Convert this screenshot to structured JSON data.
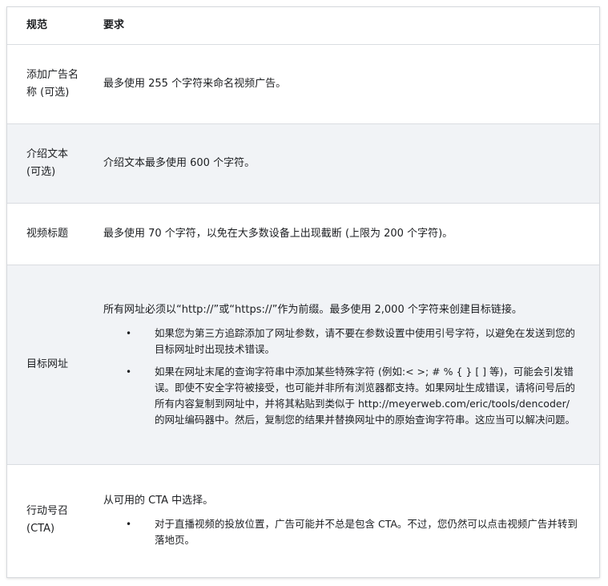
{
  "header": {
    "col1": "规范",
    "col2": "要求"
  },
  "rows": [
    {
      "label": "添加广告名称 (可选)",
      "text": "最多使用 255 个字符来命名视频广告。"
    },
    {
      "label": "介绍文本 (可选)",
      "text": "介绍文本最多使用 600 个字符。"
    },
    {
      "label": "视频标题",
      "text": "最多使用 70 个字符，以免在大多数设备上出现截断 (上限为 200 个字符)。"
    },
    {
      "label": "目标网址",
      "text": "所有网址必须以“http://”或“https://”作为前缀。最多使用 2,000 个字符来创建目标链接。",
      "bullets": [
        "如果您为第三方追踪添加了网址参数，请不要在参数设置中使用引号字符，以避免在发送到您的目标网址时出现技术错误。",
        "如果在网址末尾的查询字符串中添加某些特殊字符 (例如:< >; # % { } [ ] 等)，可能会引发错误。即使不安全字符被接受，也可能并非所有浏览器都支持。如果网址生成错误，请将问号后的所有内容复制到网址中，并将其粘贴到类似于 http://meyerweb.com/eric/tools/dencoder/ 的网址编码器中。然后，复制您的结果并替换网址中的原始查询字符串。这应当可以解决问题。"
      ]
    },
    {
      "label": "行动号召 (CTA)",
      "text": "从可用的 CTA 中选择。",
      "bullets": [
        "对于直播视频的投放位置，广告可能并不总是包含 CTA。不过，您仍然可以点击视频广告并转到落地页。"
      ]
    }
  ],
  "bullet_glyph": "•"
}
